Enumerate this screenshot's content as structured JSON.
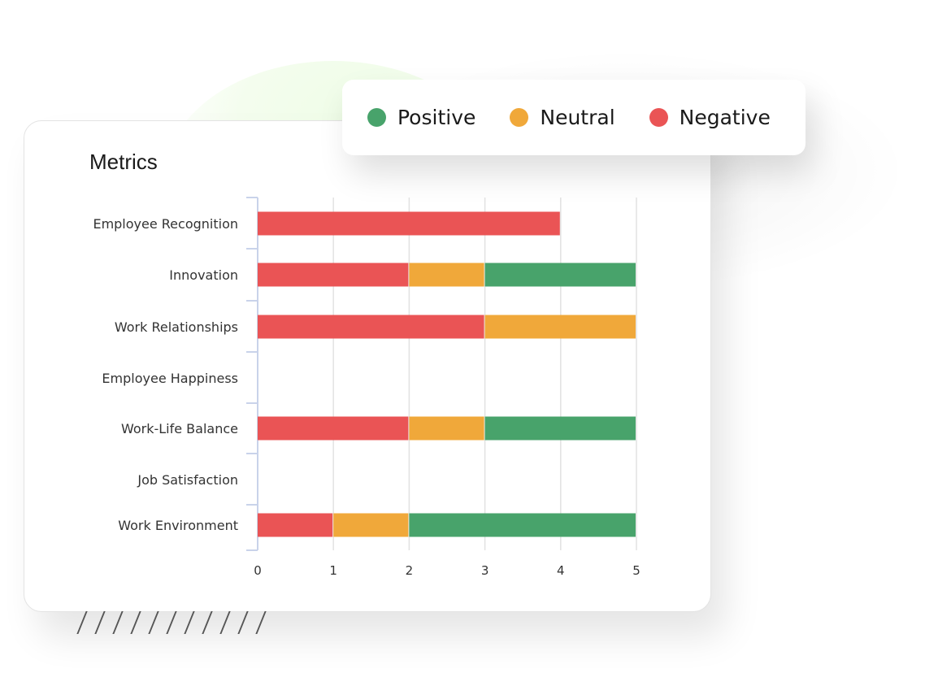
{
  "chart_data": {
    "type": "bar",
    "orientation": "horizontal",
    "stacked": true,
    "title": "Metrics",
    "xlabel": "",
    "ylabel": "",
    "xlim": [
      0,
      5
    ],
    "xticks": [
      "0",
      "1",
      "2",
      "3",
      "4",
      "5"
    ],
    "grid": true,
    "legend_position": "top-right",
    "categories": [
      "Employee Recognition",
      "Innovation",
      "Work Relationships",
      "Employee Happiness",
      "Work-Life Balance",
      "Job Satisfaction",
      "Work Environment"
    ],
    "series": [
      {
        "name": "Negative",
        "color": "#ea5455",
        "values": [
          4,
          2,
          3,
          0,
          2,
          0,
          1
        ]
      },
      {
        "name": "Neutral",
        "color": "#f0a83a",
        "values": [
          0,
          1,
          2,
          0,
          1,
          0,
          1
        ]
      },
      {
        "name": "Positive",
        "color": "#48a36b",
        "values": [
          0,
          2,
          0,
          0,
          2,
          0,
          3
        ]
      }
    ]
  },
  "legend": {
    "items": [
      {
        "label": "Positive",
        "color": "#48a36b"
      },
      {
        "label": "Neutral",
        "color": "#f0a83a"
      },
      {
        "label": "Negative",
        "color": "#ea5455"
      }
    ]
  },
  "card": {
    "title": "Metrics"
  }
}
